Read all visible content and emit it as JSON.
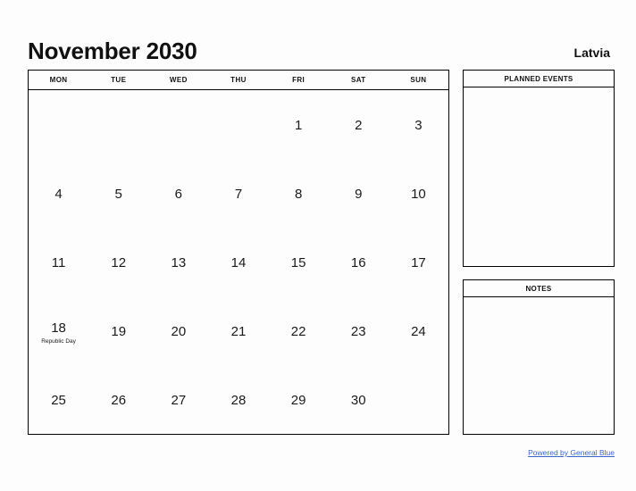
{
  "header": {
    "month_title": "November 2030",
    "country": "Latvia"
  },
  "calendar": {
    "weekdays": [
      "MON",
      "TUE",
      "WED",
      "THU",
      "FRI",
      "SAT",
      "SUN"
    ],
    "weeks": [
      [
        {
          "day": "",
          "event": ""
        },
        {
          "day": "",
          "event": ""
        },
        {
          "day": "",
          "event": ""
        },
        {
          "day": "",
          "event": ""
        },
        {
          "day": "1",
          "event": ""
        },
        {
          "day": "2",
          "event": ""
        },
        {
          "day": "3",
          "event": ""
        }
      ],
      [
        {
          "day": "4",
          "event": ""
        },
        {
          "day": "5",
          "event": ""
        },
        {
          "day": "6",
          "event": ""
        },
        {
          "day": "7",
          "event": ""
        },
        {
          "day": "8",
          "event": ""
        },
        {
          "day": "9",
          "event": ""
        },
        {
          "day": "10",
          "event": ""
        }
      ],
      [
        {
          "day": "11",
          "event": ""
        },
        {
          "day": "12",
          "event": ""
        },
        {
          "day": "13",
          "event": ""
        },
        {
          "day": "14",
          "event": ""
        },
        {
          "day": "15",
          "event": ""
        },
        {
          "day": "16",
          "event": ""
        },
        {
          "day": "17",
          "event": ""
        }
      ],
      [
        {
          "day": "18",
          "event": "Republic Day"
        },
        {
          "day": "19",
          "event": ""
        },
        {
          "day": "20",
          "event": ""
        },
        {
          "day": "21",
          "event": ""
        },
        {
          "day": "22",
          "event": ""
        },
        {
          "day": "23",
          "event": ""
        },
        {
          "day": "24",
          "event": ""
        }
      ],
      [
        {
          "day": "25",
          "event": ""
        },
        {
          "day": "26",
          "event": ""
        },
        {
          "day": "27",
          "event": ""
        },
        {
          "day": "28",
          "event": ""
        },
        {
          "day": "29",
          "event": ""
        },
        {
          "day": "30",
          "event": ""
        },
        {
          "day": "",
          "event": ""
        }
      ]
    ]
  },
  "panels": {
    "planned_events": {
      "title": "PLANNED EVENTS",
      "content": ""
    },
    "notes": {
      "title": "NOTES",
      "content": ""
    }
  },
  "footer": {
    "link_label": "Powered by General Blue",
    "link_color": "#3a66c8"
  }
}
